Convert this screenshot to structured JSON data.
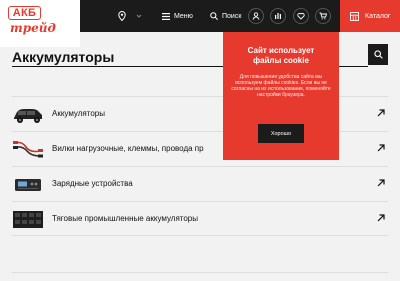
{
  "header": {
    "logo_top": "АКБ",
    "logo_bottom": "трейд",
    "menu_label": "Меню",
    "search_label": "Поиск",
    "catalog_label": "Каталог",
    "icons": [
      "location-pin-icon",
      "chevron-down-icon",
      "hamburger-icon",
      "search-icon",
      "user-icon",
      "compare-icon",
      "heart-icon",
      "cart-icon",
      "grid-icon"
    ]
  },
  "page": {
    "title": "Аккумуляторы"
  },
  "categories": [
    {
      "label": "Аккумуляторы",
      "icon": "car-battery-thumb"
    },
    {
      "label": "Вилки нагрузочные, клеммы, провода пр",
      "icon": "cables-thumb"
    },
    {
      "label": "Зарядные устройства",
      "icon": "charger-thumb"
    },
    {
      "label": "Тяговые промышленные аккумуляторы",
      "icon": "traction-battery-thumb"
    }
  ],
  "cookie": {
    "title_line1": "Сайт использует",
    "title_line2": "файлы cookie",
    "body": "Для повышения удобства сайта мы используем файлы cookies. Если вы не согласны на их использование, поменяйте настройки браузера.",
    "accept_label": "Хорошо"
  },
  "colors": {
    "accent": "#e63a2e",
    "header_bg": "#1b1b1b",
    "page_bg": "#f2f2f2"
  }
}
